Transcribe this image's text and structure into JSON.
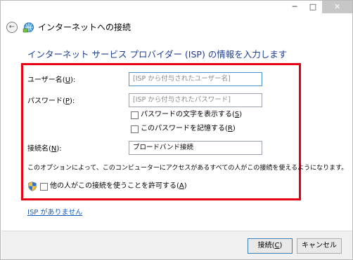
{
  "title_bar": {
    "minimize_glyph": "─",
    "maximize_glyph": "□",
    "close_glyph": "✕"
  },
  "header": {
    "back_glyph": "←",
    "window_title": "インターネットへの接続",
    "icon": "network-globe-icon"
  },
  "form": {
    "heading": "インターネット サービス プロバイダー (ISP) の情報を入力します",
    "username": {
      "label_prefix": "ユーザー名(",
      "label_key": "U",
      "label_suffix": "):",
      "placeholder": "[ISP から付与されたユーザー名]"
    },
    "password": {
      "label_prefix": "パスワード(",
      "label_key": "P",
      "label_suffix": "):",
      "placeholder": "[ISP から付与されたパスワード]"
    },
    "show_chars": {
      "label_prefix": "パスワードの文字を表示する(",
      "label_key": "S",
      "label_suffix": ")",
      "checked": false
    },
    "remember": {
      "label_prefix": "このパスワードを記憶する(",
      "label_key": "R",
      "label_suffix": ")",
      "checked": false
    },
    "connection_name": {
      "label_prefix": "接続名(",
      "label_key": "N",
      "label_suffix": "):",
      "value": "ブロードバンド接続"
    },
    "note": "このオプションによって、このコンピューターにアクセスがあるすべての人がこの接続を使えるようになります。",
    "allow_others": {
      "label_prefix": "他の人がこの接続を使うことを許可する(",
      "label_key": "A",
      "label_suffix": ")",
      "checked": false,
      "icon": "uac-shield-icon"
    },
    "highlight_color": "#e60012",
    "heading_color": "#1c3e94"
  },
  "no_isp_link": "ISP がありません",
  "footer": {
    "connect": {
      "label_prefix": "接続(",
      "label_key": "C",
      "label_suffix": ")"
    },
    "cancel_label": "キャンセル"
  }
}
